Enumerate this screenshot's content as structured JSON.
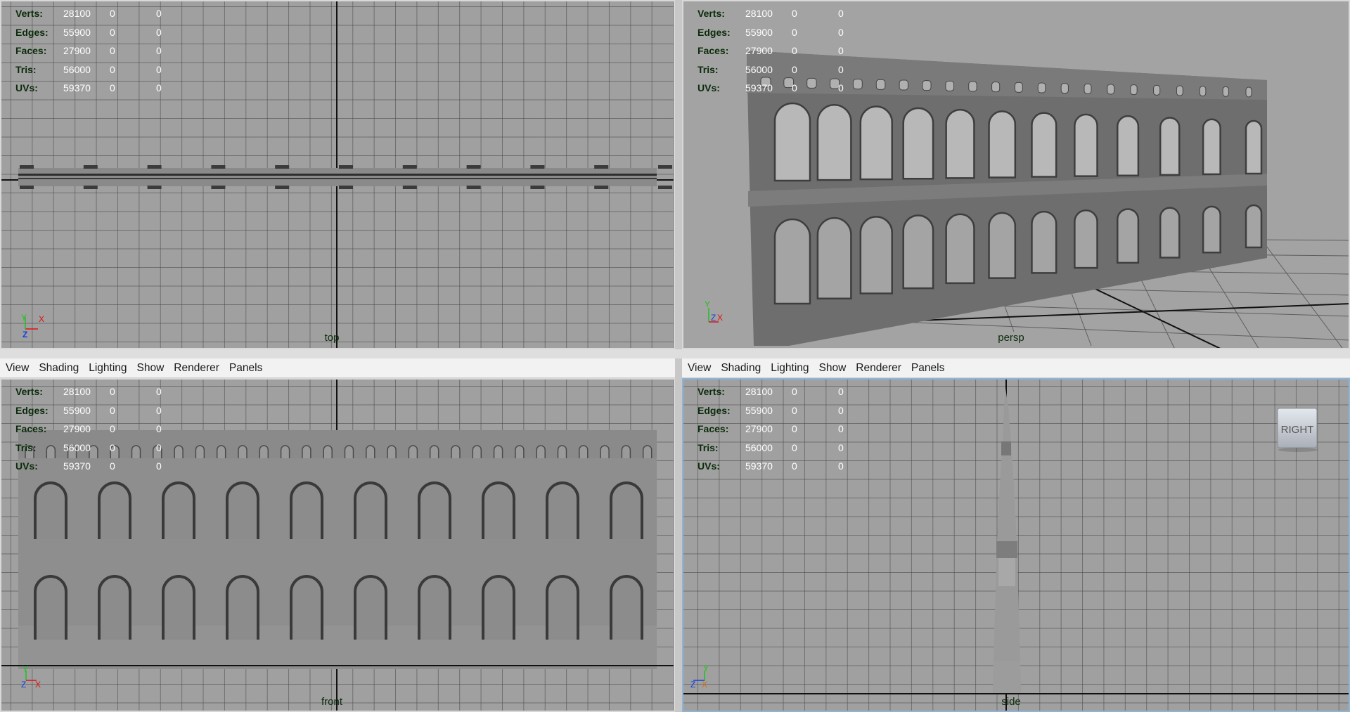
{
  "menus": [
    "View",
    "Shading",
    "Lighting",
    "Show",
    "Renderer",
    "Panels"
  ],
  "hud": {
    "rows": [
      {
        "label": "Verts:",
        "value": "28100",
        "a": "0",
        "b": "0"
      },
      {
        "label": "Edges:",
        "value": "55900",
        "a": "0",
        "b": "0"
      },
      {
        "label": "Faces:",
        "value": "27900",
        "a": "0",
        "b": "0"
      },
      {
        "label": "Tris:",
        "value": "56000",
        "a": "0",
        "b": "0"
      },
      {
        "label": "UVs:",
        "value": "59370",
        "a": "0",
        "b": "0"
      }
    ]
  },
  "viewports": {
    "top": {
      "camera": "top",
      "axes": [
        "Y",
        "X",
        "Z"
      ]
    },
    "persp": {
      "camera": "persp",
      "axes": [
        "Y",
        "Z",
        "X"
      ]
    },
    "front": {
      "camera": "front",
      "axes": [
        "Y",
        "Z",
        "X"
      ]
    },
    "side": {
      "camera": "side",
      "axes": [
        "Y",
        "Z",
        "X"
      ],
      "view_cube": "RIGHT"
    }
  },
  "colors": {
    "viewport_bg": "#a0a0a0",
    "hud_label": "#0a2b0a",
    "axis_x": "#e01010",
    "axis_y": "#20c020",
    "axis_z": "#1040e0",
    "active_border": "#8fb4d6"
  },
  "icons": [
    "axis-gizmo-icon",
    "view-cube-icon"
  ]
}
